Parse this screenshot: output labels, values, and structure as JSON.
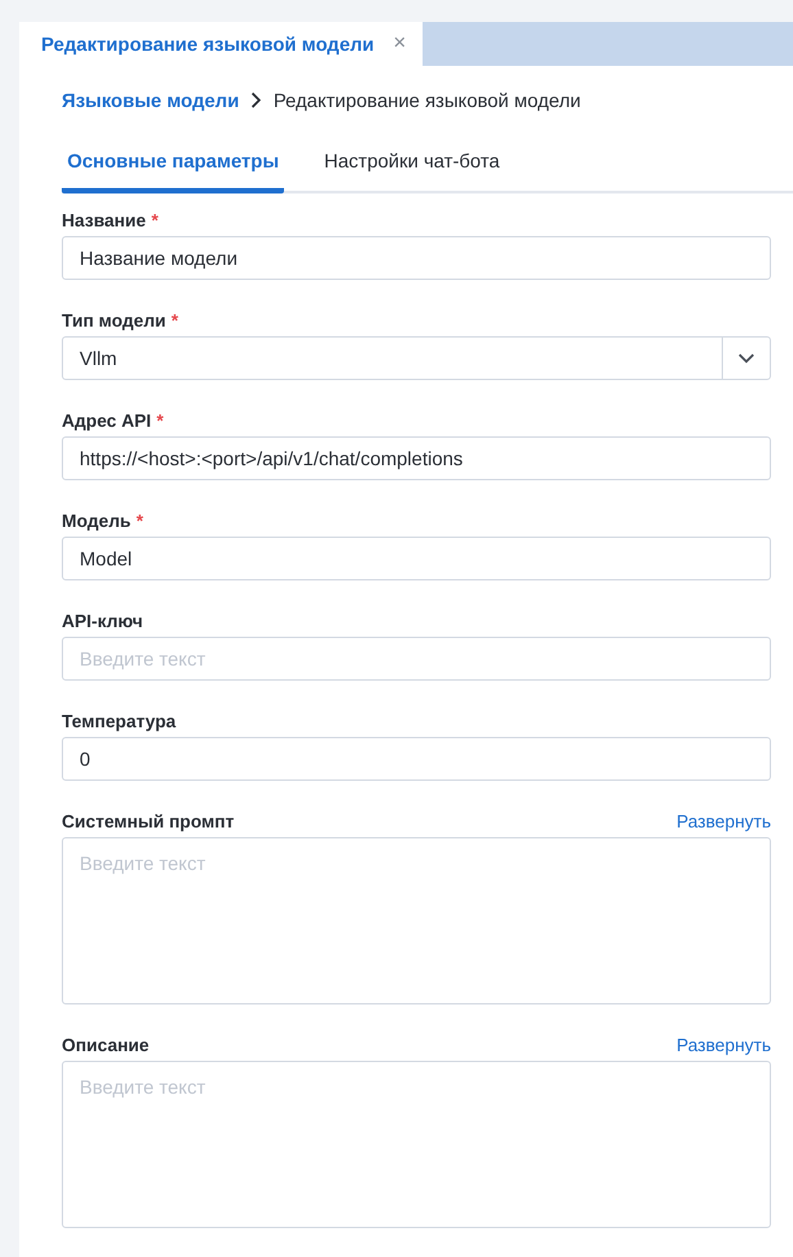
{
  "doc_tab": {
    "title": "Редактирование языковой модели",
    "close": "×"
  },
  "breadcrumbs": [
    {
      "kind": "link",
      "label": "Языковые модели"
    },
    {
      "kind": "current",
      "label": "Редактирование языковой модели"
    }
  ],
  "tabs": [
    {
      "label": "Основные параметры",
      "selected": true
    },
    {
      "label": "Настройки чат-бота",
      "selected": false
    }
  ],
  "fields": [
    {
      "kind": "text",
      "label": "Название",
      "required_mark": "*",
      "value": "Название модели"
    },
    {
      "kind": "select",
      "label": "Тип модели",
      "required_mark": "*",
      "value": "Vllm"
    },
    {
      "kind": "text",
      "label": "Адрес API",
      "required_mark": "*",
      "value": "https://<host>:<port>/api/v1/chat/completions"
    },
    {
      "kind": "text",
      "label": "Модель",
      "required_mark": "*",
      "value": "Model"
    },
    {
      "kind": "text",
      "label": "API-ключ",
      "placeholder": "Введите текст"
    },
    {
      "kind": "text",
      "label": "Температура",
      "value": "0"
    },
    {
      "kind": "textarea",
      "label": "Системный промпт",
      "placeholder": "Введите текст",
      "expand": "Развернуть"
    },
    {
      "kind": "textarea",
      "label": "Описание",
      "placeholder": "Введите текст",
      "expand": "Развернуть"
    }
  ]
}
